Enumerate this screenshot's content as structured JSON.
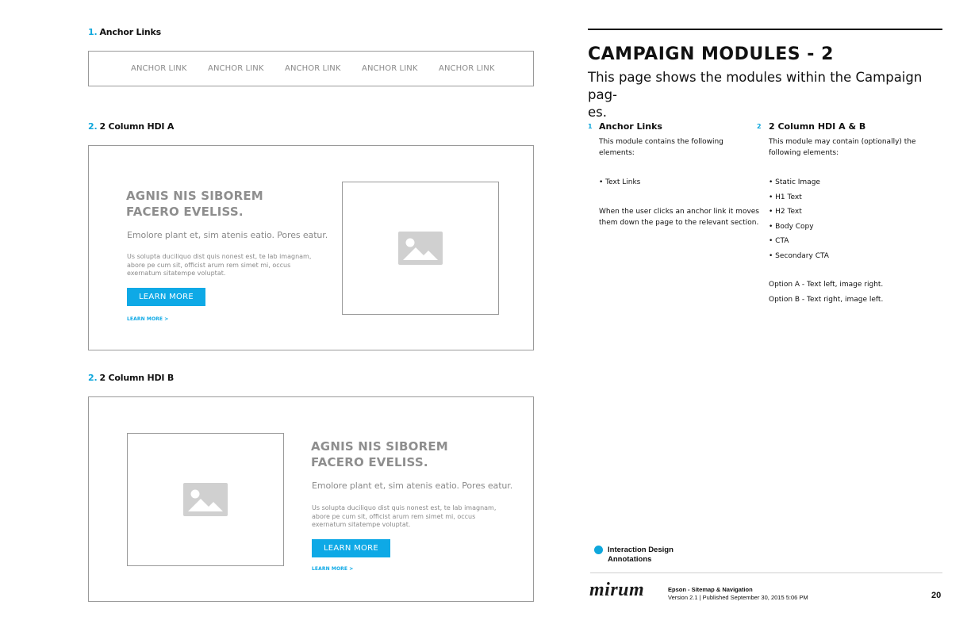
{
  "sections": {
    "anchor": {
      "num": "1.",
      "title": "Anchor Links"
    },
    "hdi_a": {
      "num": "2.",
      "title": "2 Column HDI A"
    },
    "hdi_b": {
      "num": "2.",
      "title": "2 Column HDI B"
    }
  },
  "anchor_links": [
    "ANCHOR LINK",
    "ANCHOR LINK",
    "ANCHOR LINK",
    "ANCHOR LINK",
    "ANCHOR LINK"
  ],
  "hdi": {
    "heading_line1": "AGNIS NIS SIBOREM",
    "heading_line2": "FACERO EVELISS.",
    "subhead": "Emolore plant et, sim atenis eatio. Pores eatur.",
    "body": "Us solupta duciliquo dist quis nonest est, te lab imagnam, abore pe cum sit, officist arum rem simet mi, occus exernatum sitatempe voluptat.",
    "cta": "LEARN MORE",
    "secondary_cta": "LEARN MORE >"
  },
  "page": {
    "title": "CAMPAIGN MODULES - 2",
    "subtitle_line1": "This page shows the modules within the Campaign pag-",
    "subtitle_line2": "es."
  },
  "annotations": {
    "a1": {
      "num": "1",
      "title": "Anchor Links",
      "intro_line1": "This module contains the following",
      "intro_line2": "elements:",
      "items": [
        "• Text Links"
      ],
      "note_line1": "When the user clicks an anchor link it moves",
      "note_line2": "them down the page to the relevant section."
    },
    "a2": {
      "num": "2",
      "title": "2 Column HDI A & B",
      "intro_line1": "This module may contain (optionally) the",
      "intro_line2": "following elements:",
      "items": [
        "• Static Image",
        "• H1 Text",
        "• H2 Text",
        "• Body Copy",
        "• CTA",
        "• Secondary CTA"
      ],
      "option_a": "Option A  - Text left, image right.",
      "option_b": "Option B  - Text right, image left."
    }
  },
  "legend": {
    "line1": "Interaction Design",
    "line2": "Annotations"
  },
  "footer": {
    "logo": "mirum",
    "line1": "Epson - Sitemap & Navigation",
    "line2": "Version 2.1  |  Published September 30, 2015 5:06 PM",
    "page_number": "20"
  },
  "colors": {
    "accent": "#0fa7dc",
    "button": "#0ea9e6",
    "placeholder": "#d0d0d0"
  },
  "icons": {
    "placeholder_image": "image-placeholder-icon"
  }
}
